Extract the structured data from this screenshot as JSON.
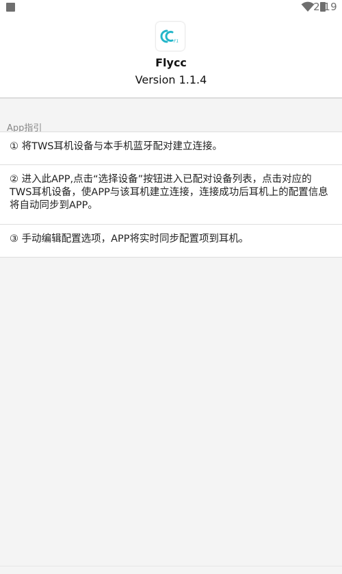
{
  "status_bar": {
    "time": "2:19",
    "icons": [
      "notification-square-icon",
      "wifi-icon",
      "battery-icon"
    ]
  },
  "header": {
    "app_name": "Flycc",
    "version": "Version 1.1.4",
    "logo_icon": "flycc-logo-icon",
    "logo_color": "#23b6c9"
  },
  "guide": {
    "section_title": "App指引",
    "items": [
      "① 将TWS耳机设备与本手机蓝牙配对建立连接。",
      "② 进入此APP,点击“选择设备”按钮进入已配对设备列表，点击对应的TWS耳机设备，使APP与该耳机建立连接，连接成功后耳机上的配置信息将自动同步到APP。",
      "③ 手动编辑配置选项，APP将实时同步配置项到耳机。"
    ]
  }
}
